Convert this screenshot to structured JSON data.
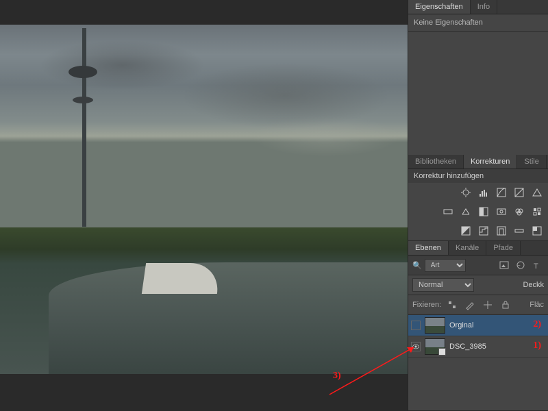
{
  "properties_panel": {
    "tabs": {
      "properties": "Eigenschaften",
      "info": "Info"
    },
    "body_text": "Keine Eigenschaften"
  },
  "adjustments_panel": {
    "tabs": {
      "libraries": "Bibliotheken",
      "adjustments": "Korrekturen",
      "styles": "Stile"
    },
    "header": "Korrektur hinzufügen"
  },
  "layers_panel": {
    "tabs": {
      "layers": "Ebenen",
      "channels": "Kanäle",
      "paths": "Pfade"
    },
    "filter_label": "Art",
    "blend_mode": "Normal",
    "opacity_label": "Deckk",
    "lock_label": "Fixieren:",
    "fill_label": "Fläc"
  },
  "layers": [
    {
      "name": "Orginal",
      "visibility_shown": false,
      "selected": true,
      "smart_object": false
    },
    {
      "name": "DSC_3985",
      "visibility_shown": true,
      "selected": false,
      "smart_object": true
    }
  ],
  "annotations": {
    "marker1": "1)",
    "marker2": "2)",
    "marker3": "3)"
  },
  "colors": {
    "annotation": "#ff1a1a",
    "panel_bg": "#454545",
    "selected_layer": "#335577"
  }
}
